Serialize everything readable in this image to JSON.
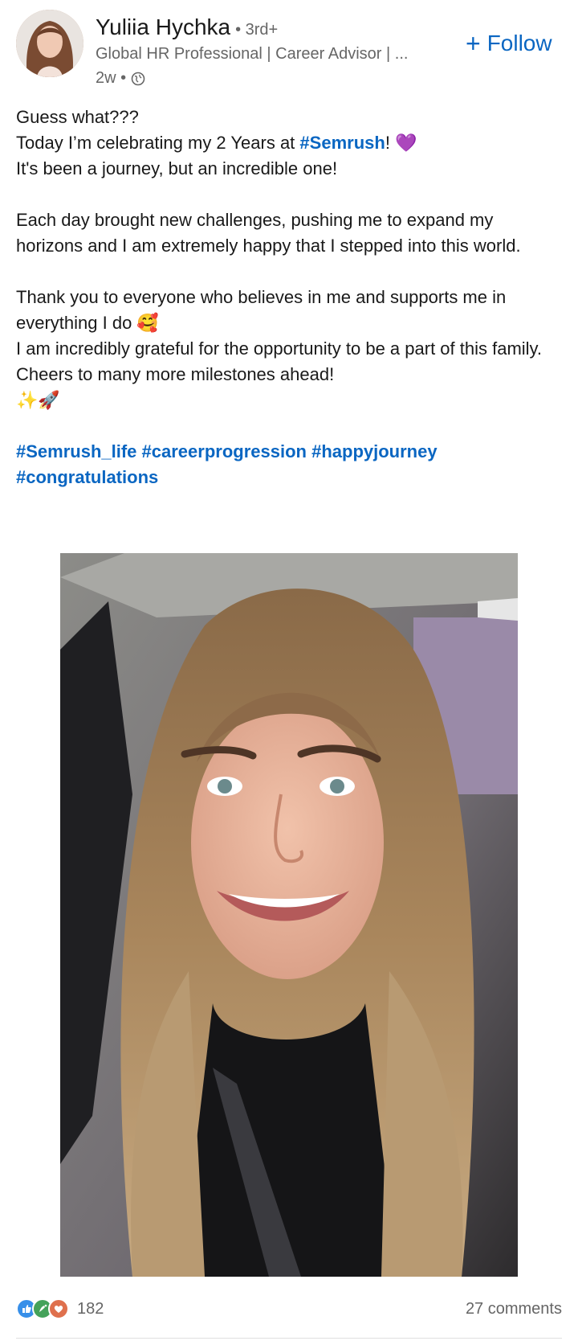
{
  "author": {
    "name": "Yuliia Hychka",
    "degree": "• 3rd+",
    "headline": "Global HR Professional | Career Advisor | ...",
    "time": "2w •",
    "avatar_icon": "profile-photo"
  },
  "follow": {
    "label": "Follow",
    "icon": "plus-icon"
  },
  "post": {
    "line1": "Guess what???",
    "line2_pre": "Today I’m celebrating my 2 Years at ",
    "line2_tag": "#Semrush",
    "line2_post": "! 💜",
    "line3": "It's been a journey, but an incredible one!",
    "para2": "Each day brought new challenges, pushing me to expand my horizons and I am extremely happy that I stepped into this world.",
    "para3_a": "Thank you to everyone who believes in me and supports me in everything I do 🥰",
    "para3_b": "I am incredibly grateful for the opportunity to be a part of this family.",
    "para3_c": "Cheers to many more milestones ahead!",
    "emoji_line": "✨🚀",
    "hashtags": [
      "#Semrush_life",
      "#careerprogression",
      "#happyjourney",
      "#congratulations"
    ]
  },
  "social": {
    "reaction_count": "182",
    "comments": "27 comments",
    "reaction_icons": [
      "like-icon",
      "celebrate-icon",
      "love-icon"
    ]
  },
  "colors": {
    "link": "#0a66c2",
    "muted": "#666666",
    "text": "#191919"
  }
}
